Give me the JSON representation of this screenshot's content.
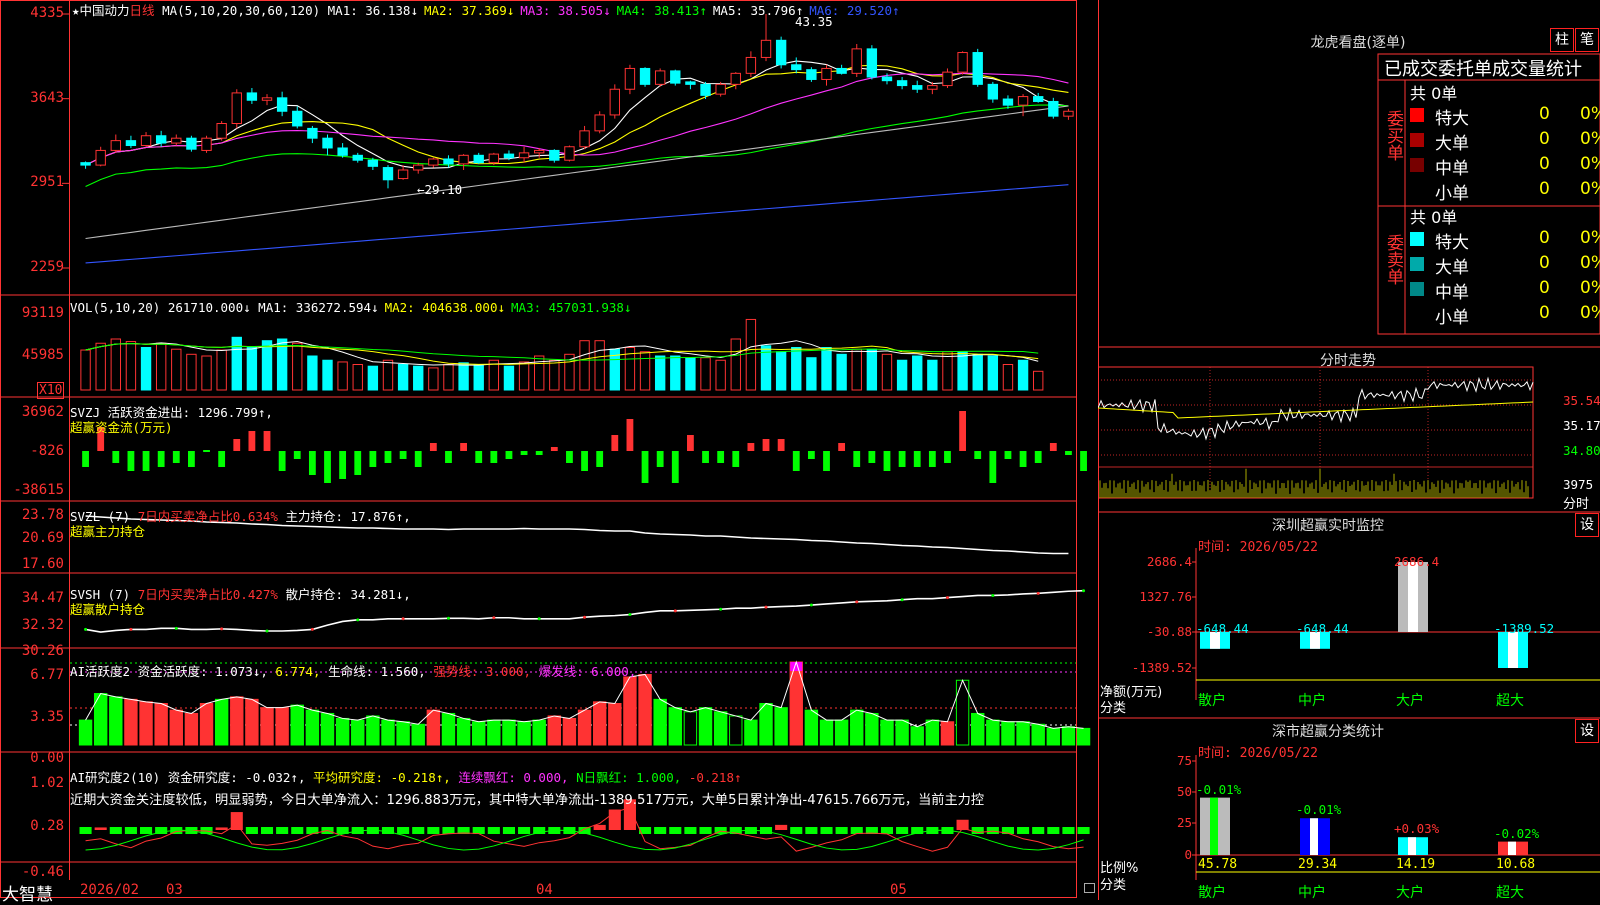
{
  "app": {
    "brand": "大智慧",
    "stock_title": "★中国动力",
    "period": "日线",
    "ma_params": "MA(5,10,20,30,60,120)",
    "ma_values": [
      {
        "label": "MA1: 36.138↓",
        "color": "#ffffff"
      },
      {
        "label": "MA2: 37.369↓",
        "color": "#ffff00"
      },
      {
        "label": "MA3: 38.505↓",
        "color": "#ff33ff"
      },
      {
        "label": "MA4: 38.413↑",
        "color": "#00ff00"
      },
      {
        "label": "MA5: 35.796↑",
        "color": "#ffffff"
      },
      {
        "label": "MA6: 29.520↑",
        "color": "#3355ff"
      }
    ],
    "price_axis": [
      "4335",
      "3643",
      "2951",
      "2259"
    ],
    "high_marker": "43.35",
    "low_marker": "←29.10",
    "x_axis": [
      "2026/02",
      "03",
      "04",
      "05"
    ]
  },
  "vol": {
    "header": "VOL(5,10,20)",
    "value": "261710.000↓",
    "ma": [
      {
        "label": "MA1: 336272.594↓",
        "color": "#ffffff"
      },
      {
        "label": "MA2: 404638.000↓",
        "color": "#ffff00"
      },
      {
        "label": "MA3: 457031.938↓",
        "color": "#00ff00"
      }
    ],
    "axis": [
      "93119",
      "45985"
    ],
    "unit": "X10",
    "bars": [
      {
        "v": 0.47,
        "c": "r"
      },
      {
        "v": 0.55,
        "c": "r"
      },
      {
        "v": 0.6,
        "c": "r"
      },
      {
        "v": 0.57,
        "c": "r"
      },
      {
        "v": 0.5,
        "c": "c"
      },
      {
        "v": 0.55,
        "c": "r"
      },
      {
        "v": 0.48,
        "c": "r"
      },
      {
        "v": 0.42,
        "c": "r"
      },
      {
        "v": 0.4,
        "c": "r"
      },
      {
        "v": 0.47,
        "c": "r"
      },
      {
        "v": 0.62,
        "c": "c"
      },
      {
        "v": 0.5,
        "c": "c"
      },
      {
        "v": 0.58,
        "c": "c"
      },
      {
        "v": 0.6,
        "c": "c"
      },
      {
        "v": 0.55,
        "c": "r"
      },
      {
        "v": 0.4,
        "c": "c"
      },
      {
        "v": 0.35,
        "c": "c"
      },
      {
        "v": 0.33,
        "c": "r"
      },
      {
        "v": 0.3,
        "c": "r"
      },
      {
        "v": 0.28,
        "c": "c"
      },
      {
        "v": 0.35,
        "c": "r"
      },
      {
        "v": 0.3,
        "c": "c"
      },
      {
        "v": 0.28,
        "c": "c"
      },
      {
        "v": 0.26,
        "c": "r"
      },
      {
        "v": 0.3,
        "c": "r"
      },
      {
        "v": 0.32,
        "c": "c"
      },
      {
        "v": 0.3,
        "c": "c"
      },
      {
        "v": 0.35,
        "c": "r"
      },
      {
        "v": 0.28,
        "c": "c"
      },
      {
        "v": 0.33,
        "c": "r"
      },
      {
        "v": 0.4,
        "c": "r"
      },
      {
        "v": 0.35,
        "c": "r"
      },
      {
        "v": 0.42,
        "c": "r"
      },
      {
        "v": 0.58,
        "c": "r"
      },
      {
        "v": 0.58,
        "c": "r"
      },
      {
        "v": 0.48,
        "c": "c"
      },
      {
        "v": 0.5,
        "c": "r"
      },
      {
        "v": 0.45,
        "c": "r"
      },
      {
        "v": 0.4,
        "c": "c"
      },
      {
        "v": 0.4,
        "c": "c"
      },
      {
        "v": 0.38,
        "c": "c"
      },
      {
        "v": 0.38,
        "c": "r"
      },
      {
        "v": 0.35,
        "c": "r"
      },
      {
        "v": 0.6,
        "c": "r"
      },
      {
        "v": 0.83,
        "c": "r"
      },
      {
        "v": 0.52,
        "c": "c"
      },
      {
        "v": 0.45,
        "c": "c"
      },
      {
        "v": 0.5,
        "c": "c"
      },
      {
        "v": 0.38,
        "c": "c"
      },
      {
        "v": 0.5,
        "c": "c"
      },
      {
        "v": 0.42,
        "c": "c"
      },
      {
        "v": 0.48,
        "c": "r"
      },
      {
        "v": 0.48,
        "c": "c"
      },
      {
        "v": 0.42,
        "c": "r"
      },
      {
        "v": 0.35,
        "c": "c"
      },
      {
        "v": 0.4,
        "c": "c"
      },
      {
        "v": 0.35,
        "c": "c"
      },
      {
        "v": 0.45,
        "c": "r"
      },
      {
        "v": 0.45,
        "c": "c"
      },
      {
        "v": 0.42,
        "c": "c"
      },
      {
        "v": 0.4,
        "c": "c"
      },
      {
        "v": 0.3,
        "c": "r"
      },
      {
        "v": 0.35,
        "c": "c"
      },
      {
        "v": 0.22,
        "c": "r"
      }
    ]
  },
  "svzj": {
    "header": "SVZJ  活跃资金进出: 1296.799↑,",
    "name": "超赢资金流(万元)",
    "axis": [
      "36962",
      "-826",
      "-38615"
    ],
    "values": [
      -0.4,
      0.6,
      -0.3,
      -0.5,
      -0.5,
      -0.4,
      -0.3,
      -0.4,
      0.0,
      -0.4,
      0.3,
      0.5,
      0.5,
      -0.5,
      -0.2,
      -0.6,
      -0.8,
      -0.7,
      -0.6,
      -0.4,
      -0.3,
      -0.2,
      -0.4,
      0.2,
      -0.3,
      0.2,
      -0.3,
      -0.3,
      -0.2,
      -0.1,
      -0.1,
      0.1,
      -0.3,
      -0.5,
      -0.4,
      0.4,
      0.8,
      -0.8,
      -0.4,
      -0.8,
      0.4,
      -0.3,
      -0.3,
      -0.4,
      0.2,
      0.3,
      0.3,
      -0.5,
      -0.2,
      -0.5,
      0.2,
      -0.4,
      -0.3,
      -0.5,
      -0.4,
      -0.4,
      -0.4,
      -0.3,
      1.0,
      -0.2,
      -0.8,
      -0.2,
      -0.4,
      -0.3,
      0.2,
      -0.1,
      -0.5
    ]
  },
  "svzl": {
    "header_a": "SVZL (7)",
    "header_b": "7日内买卖净占比0.634%",
    "header_c": "主力持仓: 17.876↑,",
    "name": "超赢主力持仓",
    "axis": [
      "23.78",
      "20.69",
      "17.60"
    ],
    "values": [
      0.92,
      0.9,
      0.88,
      0.86,
      0.85,
      0.84,
      0.83,
      0.82,
      0.8,
      0.79,
      0.78,
      0.76,
      0.75,
      0.73,
      0.72,
      0.71,
      0.7,
      0.69,
      0.68,
      0.68,
      0.67,
      0.66,
      0.66,
      0.66,
      0.65,
      0.66,
      0.66,
      0.66,
      0.66,
      0.67,
      0.66,
      0.66,
      0.66,
      0.65,
      0.63,
      0.62,
      0.62,
      0.58,
      0.56,
      0.55,
      0.54,
      0.52,
      0.52,
      0.5,
      0.48,
      0.47,
      0.46,
      0.45,
      0.43,
      0.42,
      0.4,
      0.38,
      0.37,
      0.35,
      0.33,
      0.32,
      0.3,
      0.29,
      0.27,
      0.25,
      0.23,
      0.22,
      0.2,
      0.18,
      0.17,
      0.17
    ]
  },
  "svsh": {
    "header_a": "SVSH (7)",
    "header_b": "7日内买卖净占比0.427%",
    "header_c": "散户持仓: 34.281↓,",
    "name": "超赢散户持仓",
    "axis": [
      "34.47",
      "32.32",
      "30.26"
    ],
    "values": [
      0.2,
      0.15,
      0.18,
      0.2,
      0.2,
      0.22,
      0.22,
      0.2,
      0.2,
      0.21,
      0.2,
      0.18,
      0.17,
      0.17,
      0.18,
      0.2,
      0.28,
      0.35,
      0.38,
      0.38,
      0.4,
      0.4,
      0.4,
      0.4,
      0.41,
      0.41,
      0.4,
      0.42,
      0.42,
      0.4,
      0.4,
      0.4,
      0.4,
      0.43,
      0.45,
      0.46,
      0.48,
      0.52,
      0.55,
      0.55,
      0.56,
      0.57,
      0.58,
      0.6,
      0.6,
      0.62,
      0.63,
      0.64,
      0.66,
      0.68,
      0.7,
      0.72,
      0.73,
      0.74,
      0.76,
      0.78,
      0.78,
      0.8,
      0.82,
      0.84,
      0.84,
      0.85,
      0.87,
      0.88,
      0.9,
      0.92,
      0.93
    ]
  },
  "ai_act": {
    "label_a": "AI活跃度2",
    "label_b": "资金活跃度: 1.073↓,",
    "label_c": "6.774,",
    "label_d": "生命线: 1.560,",
    "label_e": "强势线: 3.000,",
    "label_f": "爆发线: 6.000,",
    "axis": [
      "6.77",
      "3.35",
      "0.00"
    ],
    "values": [
      0.3,
      0.62,
      0.58,
      0.55,
      0.52,
      0.5,
      0.42,
      0.38,
      0.5,
      0.55,
      0.58,
      0.55,
      0.45,
      0.45,
      0.48,
      0.42,
      0.38,
      0.32,
      0.3,
      0.35,
      0.3,
      0.28,
      0.25,
      0.42,
      0.38,
      0.32,
      0.28,
      0.3,
      0.3,
      0.28,
      0.3,
      0.35,
      0.32,
      0.42,
      0.52,
      0.5,
      0.82,
      0.85,
      0.55,
      0.45,
      0.4,
      0.45,
      0.4,
      0.35,
      0.3,
      0.5,
      0.45,
      1.0,
      0.42,
      0.3,
      0.3,
      0.42,
      0.38,
      0.3,
      0.3,
      0.22,
      0.3,
      0.28,
      0.78,
      0.38,
      0.3,
      0.28,
      0.28,
      0.25,
      0.2,
      0.22,
      0.2
    ],
    "colors": "gggrrrrrrgrrrrgggggggggrgggggggrrrrrrrggwggwgggrgggggggggrwggggggg"
  },
  "ai_res": {
    "label_a": "AI研究度2(10)",
    "label_b": "资金研究度: -0.032↑,",
    "label_c": "平均研究度: -0.218↑,",
    "label_d": "连续飘红: 0.000,",
    "label_e": "N日飘红: 1.000,",
    "label_f": "-0.218↑",
    "note": "近期大资金关注度较低，明显弱势，今日大单净流入：1296.883万元，其中特大单净流出-1389.517万元，大单5日累计净出-47615.766万元，当前主力控",
    "axis": [
      "1.02",
      "0.28",
      "-0.46"
    ],
    "values": [
      -0.1,
      0.05,
      0.0,
      -0.1,
      -0.05,
      -0.1,
      -0.05,
      -0.05,
      0.0,
      0.05,
      0.35,
      0.0,
      -0.05,
      -0.1,
      -0.15,
      -0.1,
      -0.05,
      -0.1,
      -0.05,
      -0.1,
      -0.1,
      -0.05,
      -0.1,
      -0.05,
      -0.1,
      -0.1,
      -0.05,
      -0.1,
      -0.05,
      -0.05,
      0.0,
      -0.05,
      -0.1,
      0.0,
      0.1,
      0.4,
      0.6,
      0.0,
      -0.1,
      -0.1,
      -0.15,
      -0.1,
      -0.05,
      -0.1,
      -0.1,
      -0.05,
      0.1,
      -0.15,
      -0.1,
      -0.1,
      -0.15,
      -0.1,
      -0.1,
      -0.05,
      -0.1,
      -0.1,
      -0.15,
      -0.1,
      0.2,
      0.0,
      -0.05,
      -0.1,
      -0.15,
      -0.1,
      -0.1,
      -0.1,
      -0.1
    ]
  },
  "right": {
    "lhb_title": "龙虎看盘(逐单)",
    "btn_bar": "柱",
    "btn_pen": "笔",
    "cols": "已成交委托单成交量统计",
    "buy_side": "委买单",
    "sell_side": "委卖单",
    "buy_total": "共 0单",
    "sell_total": "共 0单",
    "buy_rows": [
      {
        "name": "特大",
        "val": "0",
        "pct": "0%",
        "color": "#ff0000"
      },
      {
        "name": "大单",
        "val": "0",
        "pct": "0%",
        "color": "#aa0000"
      },
      {
        "name": "中单",
        "val": "0",
        "pct": "0%",
        "color": "#770000"
      },
      {
        "name": "小单",
        "val": "0",
        "pct": "0%",
        "color": ""
      }
    ],
    "sell_rows": [
      {
        "name": "特大",
        "val": "0",
        "pct": "0%",
        "color": "#00ffff"
      },
      {
        "name": "大单",
        "val": "0",
        "pct": "0%",
        "color": "#00aaaa"
      },
      {
        "name": "中单",
        "val": "0",
        "pct": "0%",
        "color": "#008888"
      },
      {
        "name": "小单",
        "val": "0",
        "pct": "0%",
        "color": ""
      }
    ],
    "fenshi_title": "分时走势",
    "fenshi_axis": [
      "35.54",
      "35.17",
      "34.80",
      "3975",
      "分时"
    ],
    "monitor_title": "深圳超赢实时监控",
    "monitor_time": "时间: 2026/05/22",
    "monitor_btn": "设",
    "monitor_axis": [
      "2686.4",
      "1327.76",
      "-30.88",
      "-1389.52"
    ],
    "monitor_ylabel": "净额(万元)",
    "monitor_xlabel": "分类",
    "monitor_vals": [
      "-648.44",
      "-648.44",
      "2686.4",
      "-1389.52"
    ],
    "monitor_cats": [
      "散户",
      "中户",
      "大户",
      "超大"
    ],
    "stat_title": "深市超赢分类统计",
    "stat_time": "时间: 2026/05/22",
    "stat_btn": "设",
    "stat_axis": [
      "75",
      "50",
      "25",
      "0"
    ],
    "stat_ylabel": "比例%",
    "stat_xlabel": "分类",
    "stat_top": [
      "-0.01%",
      "-0.01%",
      "+0.03%",
      "-0.02%"
    ],
    "stat_bottom": [
      "45.78",
      "29.34",
      "14.19",
      "10.68"
    ],
    "stat_cats": [
      "散户",
      "中户",
      "大户",
      "超大"
    ]
  },
  "chart_data": {
    "type": "candlestick",
    "title": "中国动力 日线",
    "x": [
      "2026/02",
      "03",
      "04",
      "05"
    ],
    "ylim": [
      22.59,
      43.35
    ],
    "ohlc": [
      [
        31.2,
        31.3,
        30.7,
        31.0
      ],
      [
        31.0,
        32.5,
        30.9,
        32.2
      ],
      [
        32.2,
        33.5,
        32.0,
        33.0
      ],
      [
        33.0,
        33.4,
        32.4,
        32.6
      ],
      [
        32.6,
        33.7,
        32.5,
        33.4
      ],
      [
        33.4,
        33.8,
        32.5,
        32.8
      ],
      [
        32.8,
        33.5,
        32.6,
        33.2
      ],
      [
        33.2,
        33.4,
        32.1,
        32.3
      ],
      [
        32.2,
        33.4,
        32.0,
        33.2
      ],
      [
        33.2,
        34.6,
        33.0,
        34.4
      ],
      [
        34.4,
        37.2,
        34.0,
        36.9
      ],
      [
        36.9,
        37.3,
        36.0,
        36.3
      ],
      [
        36.3,
        36.8,
        35.9,
        36.5
      ],
      [
        36.5,
        37.0,
        35.0,
        35.4
      ],
      [
        35.4,
        35.8,
        34.0,
        34.2
      ],
      [
        34.0,
        34.2,
        32.8,
        33.2
      ],
      [
        33.2,
        33.5,
        31.8,
        32.4
      ],
      [
        32.4,
        32.8,
        31.6,
        31.8
      ],
      [
        31.8,
        32.0,
        31.2,
        31.4
      ],
      [
        31.4,
        31.6,
        30.6,
        30.9
      ],
      [
        30.8,
        31.0,
        29.1,
        29.8
      ],
      [
        29.9,
        31.0,
        29.8,
        30.6
      ],
      [
        30.6,
        31.2,
        30.3,
        31.0
      ],
      [
        31.0,
        31.6,
        30.8,
        31.5
      ],
      [
        31.5,
        31.8,
        30.8,
        31.1
      ],
      [
        31.1,
        31.9,
        30.6,
        31.8
      ],
      [
        31.8,
        32.0,
        31.1,
        31.2
      ],
      [
        31.2,
        32.0,
        31.0,
        31.9
      ],
      [
        31.9,
        32.2,
        31.4,
        31.6
      ],
      [
        31.6,
        32.5,
        31.2,
        32.0
      ],
      [
        32.0,
        32.4,
        31.6,
        32.2
      ],
      [
        32.2,
        32.3,
        31.2,
        31.4
      ],
      [
        31.4,
        32.6,
        31.3,
        32.5
      ],
      [
        32.5,
        34.2,
        32.3,
        33.8
      ],
      [
        33.8,
        35.4,
        33.6,
        35.1
      ],
      [
        35.1,
        37.6,
        34.8,
        37.2
      ],
      [
        37.2,
        39.2,
        36.8,
        38.9
      ],
      [
        38.9,
        39.0,
        37.4,
        37.6
      ],
      [
        37.6,
        38.9,
        37.4,
        38.7
      ],
      [
        38.7,
        38.8,
        37.5,
        37.7
      ],
      [
        37.8,
        37.9,
        37.2,
        37.6
      ],
      [
        37.6,
        37.8,
        36.4,
        36.7
      ],
      [
        36.8,
        37.8,
        36.6,
        37.6
      ],
      [
        37.6,
        38.6,
        37.2,
        38.5
      ],
      [
        38.5,
        40.3,
        38.2,
        39.8
      ],
      [
        39.8,
        43.35,
        39.5,
        41.2
      ],
      [
        41.2,
        41.5,
        38.9,
        39.2
      ],
      [
        39.2,
        39.8,
        38.5,
        38.8
      ],
      [
        38.8,
        39.0,
        37.8,
        38.0
      ],
      [
        38.0,
        39.2,
        37.5,
        38.9
      ],
      [
        38.9,
        39.2,
        38.4,
        38.5
      ],
      [
        38.5,
        40.9,
        38.2,
        40.5
      ],
      [
        40.5,
        40.8,
        38.0,
        38.2
      ],
      [
        38.2,
        38.5,
        37.6,
        37.9
      ],
      [
        37.9,
        38.2,
        37.2,
        37.5
      ],
      [
        37.5,
        37.9,
        36.9,
        37.2
      ],
      [
        37.2,
        37.8,
        36.8,
        37.5
      ],
      [
        37.5,
        38.9,
        37.3,
        38.6
      ],
      [
        38.6,
        40.3,
        38.4,
        40.2
      ],
      [
        40.2,
        40.5,
        37.4,
        37.6
      ],
      [
        37.6,
        37.8,
        36.1,
        36.4
      ],
      [
        36.4,
        36.7,
        35.6,
        35.9
      ],
      [
        35.9,
        36.8,
        35.0,
        36.6
      ],
      [
        36.6,
        36.9,
        36.1,
        36.2
      ],
      [
        36.2,
        36.5,
        34.8,
        35.0
      ],
      [
        35.0,
        35.6,
        34.7,
        35.4
      ]
    ]
  }
}
